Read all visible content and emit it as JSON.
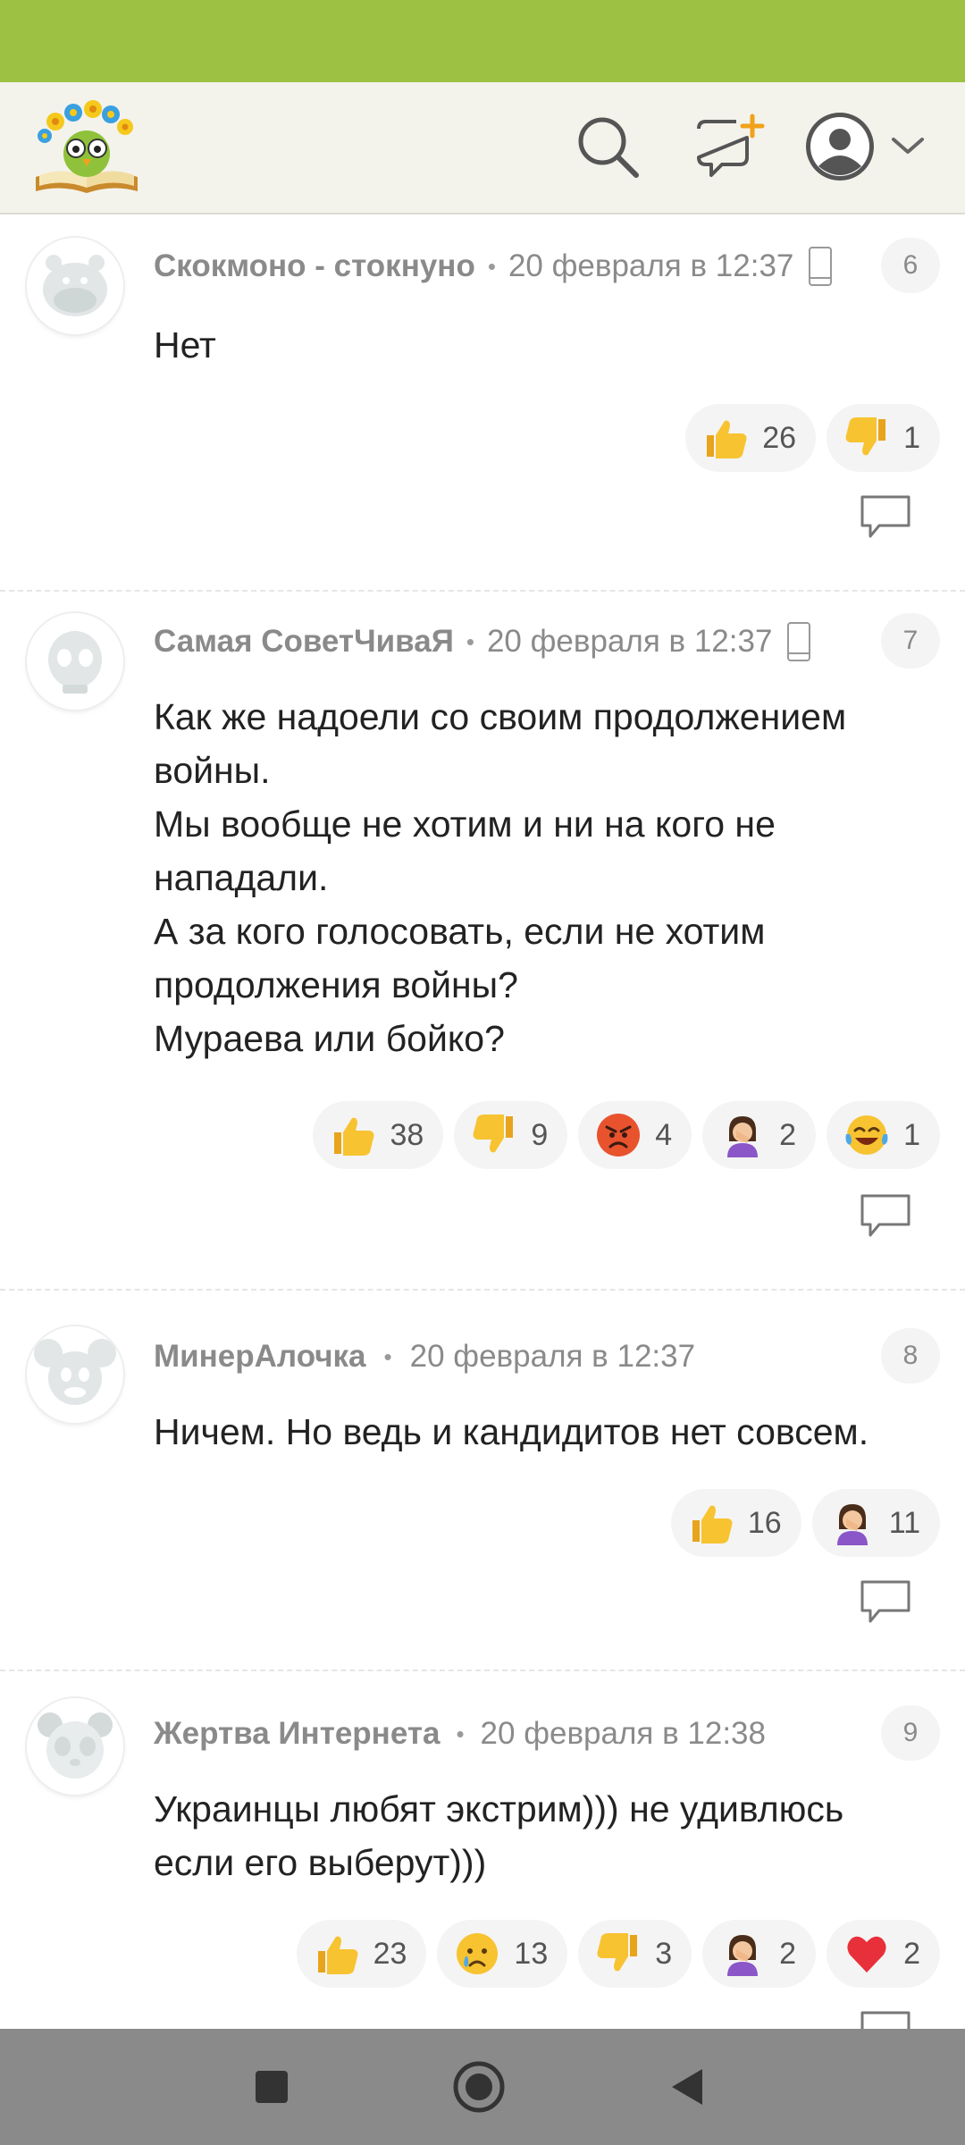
{
  "header": {
    "logo_icon": "sunflower-owl-book-logo",
    "search_icon": "search-icon",
    "new_post_icon": "new-post-icon",
    "avatar_icon": "user-avatar-icon",
    "dropdown_icon": "chevron-down-icon"
  },
  "colors": {
    "status_bar": "#9dc243",
    "header_bg": "#f3f3ec",
    "nav_bar": "#8a8a8a",
    "meta_text": "#8a8a8a"
  },
  "comments": [
    {
      "author": "Скокмоно - стокнуно",
      "date": "20 февраля в 12:37",
      "device_icon": "phone-icon",
      "number": "6",
      "lines": [
        "Нет"
      ],
      "reactions": [
        {
          "icon": "thumbs-up-icon",
          "count": "26"
        },
        {
          "icon": "thumbs-down-icon",
          "count": "1"
        }
      ]
    },
    {
      "author": "Самая СоветЧиваЯ",
      "date": "20 февраля в 12:37",
      "device_icon": "phone-icon",
      "number": "7",
      "lines": [
        "Как же надоели со своим продолжением",
        "войны.",
        "Мы вообще не хотим и ни на кого не",
        "нападали.",
        "А за кого голосовать, если не хотим",
        "продолжения войны?",
        "Мураева или бойко?"
      ],
      "reactions": [
        {
          "icon": "thumbs-up-icon",
          "count": "38"
        },
        {
          "icon": "thumbs-down-icon",
          "count": "9"
        },
        {
          "icon": "angry-face-icon",
          "count": "4"
        },
        {
          "icon": "facepalm-icon",
          "count": "2"
        },
        {
          "icon": "tears-of-joy-icon",
          "count": "1"
        }
      ]
    },
    {
      "author": "МинерАлочка",
      "date": "20 февраля в 12:37",
      "number": "8",
      "lines": [
        "Ничем. Но ведь и кандидитов нет совсем."
      ],
      "reactions": [
        {
          "icon": "thumbs-up-icon",
          "count": "16"
        },
        {
          "icon": "facepalm-icon",
          "count": "11"
        }
      ]
    },
    {
      "author": "Жертва Интернета",
      "date": "20 февраля в 12:38",
      "number": "9",
      "lines": [
        "Украинцы любят экстрим))) не удивлюсь",
        "если его выберут)))"
      ],
      "reactions": [
        {
          "icon": "thumbs-up-icon",
          "count": "23"
        },
        {
          "icon": "crying-face-icon",
          "count": "13"
        },
        {
          "icon": "thumbs-down-icon",
          "count": "3"
        },
        {
          "icon": "facepalm-icon",
          "count": "2"
        },
        {
          "icon": "red-heart-icon",
          "count": "2"
        }
      ]
    }
  ],
  "navigation": {
    "recents_icon": "square-recents-icon",
    "home_icon": "circle-home-icon",
    "back_icon": "triangle-back-icon"
  }
}
